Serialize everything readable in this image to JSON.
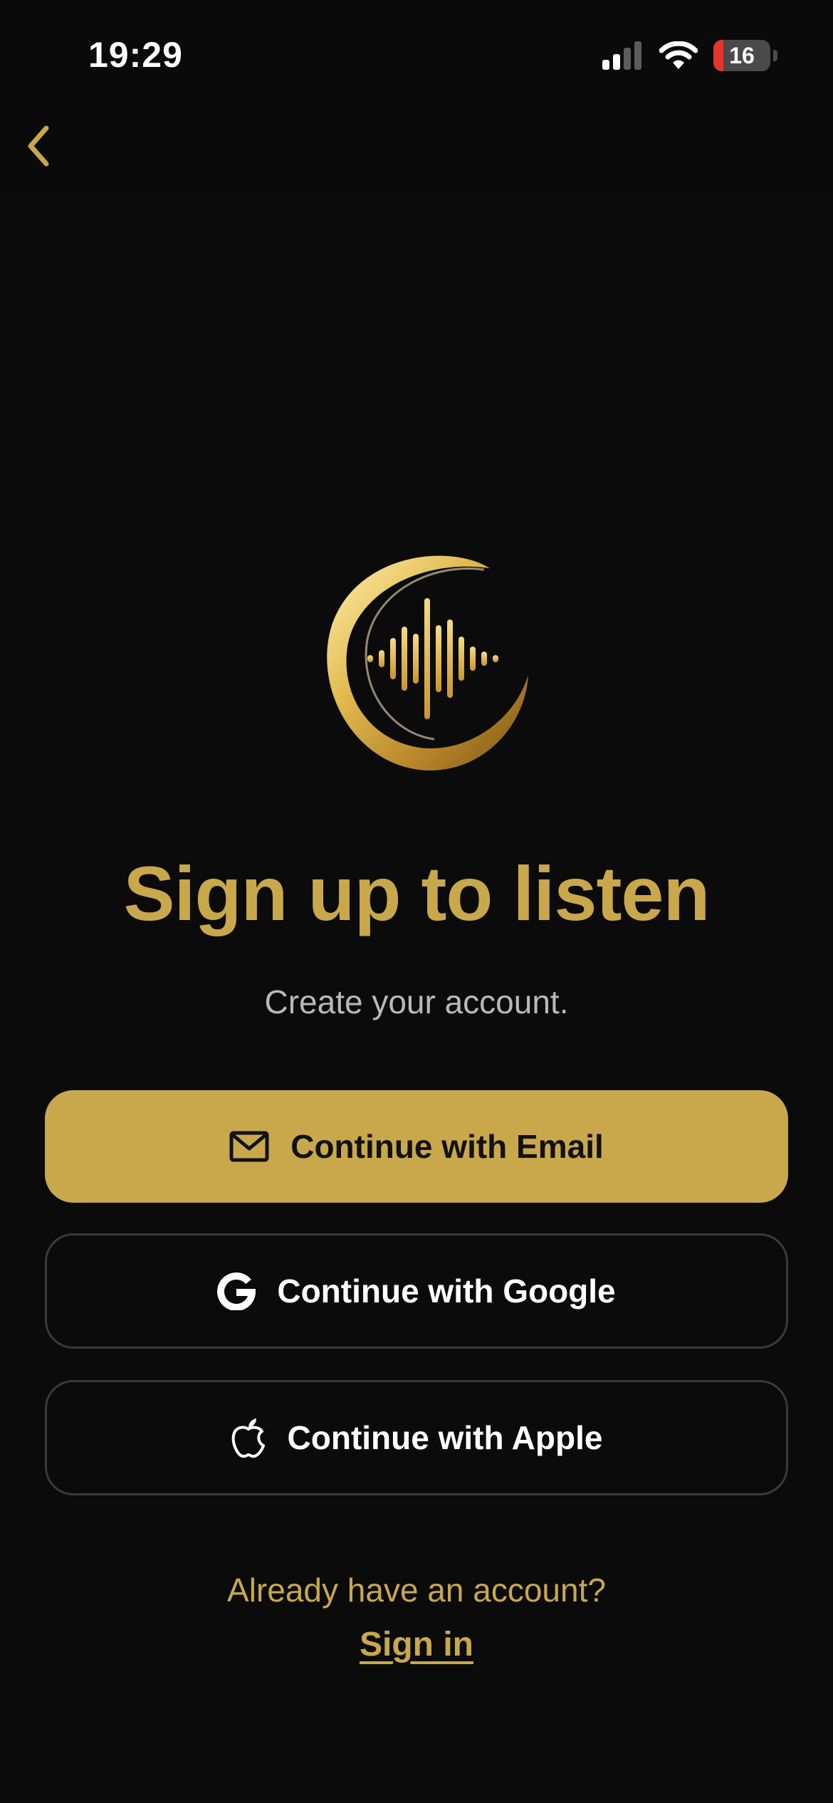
{
  "status_bar": {
    "time": "19:29",
    "battery": "16",
    "icons": [
      "signal-icon",
      "wifi-icon",
      "battery-icon"
    ]
  },
  "nav": {
    "back_icon": "chevron-left-icon"
  },
  "logo": {
    "icon": "crescent-soundwave-logo"
  },
  "hero": {
    "title": "Sign up to listen",
    "subtitle": "Create your account."
  },
  "buttons": {
    "email": {
      "label": "Continue with Email",
      "icon": "mail-icon"
    },
    "google": {
      "label": "Continue with Google",
      "icon": "google-icon"
    },
    "apple": {
      "label": "Continue with Apple",
      "icon": "apple-icon"
    }
  },
  "footer": {
    "prompt": "Already have an account?",
    "signin_label": "Sign in"
  },
  "colors": {
    "background": "#0b0b0b",
    "accent_gold": "#c9a84c",
    "outline": "#3a3a3a",
    "subtitle_gray": "#b9b9b9",
    "battery_low": "#e5352f"
  }
}
